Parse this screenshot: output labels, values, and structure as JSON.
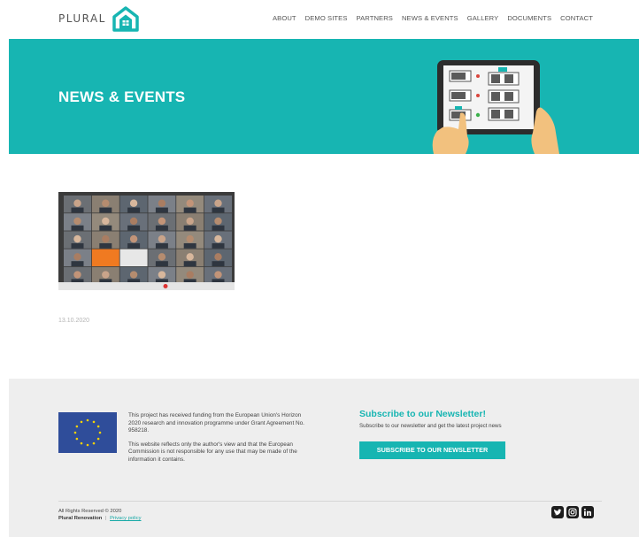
{
  "header": {
    "logo_text": "PLURAL",
    "nav": [
      "ABOUT",
      "DEMO SITES",
      "PARTNERS",
      "NEWS & EVENTS",
      "GALLERY",
      "DOCUMENTS",
      "CONTACT"
    ]
  },
  "banner": {
    "title": "NEWS & EVENTS"
  },
  "post": {
    "date": "13.10.2020"
  },
  "footer": {
    "funding_text": "This project has received funding from the European Union's Horizon 2020 research and innovation programme under Grant Agreement No. 958218.",
    "disclaimer_text": "This website reflects only the author's view and that the European Commission is not responsible for any use that may be made of the information it contains.",
    "newsletter_title": "Subscribe to our Newsletter!",
    "newsletter_sub": "Subscribe to our newsletter and get the latest project news",
    "newsletter_button": "SUBSCRIBE TO OUR NEWSLETTER",
    "rights": "All Rights Reserved © 2020",
    "brand": "Plural Renovation",
    "separator": "|",
    "privacy": "Privacy policy",
    "social_icons": [
      "twitter-icon",
      "instagram-icon",
      "linkedin-icon"
    ]
  },
  "colors": {
    "accent": "#17b5b2",
    "footer_bg": "#eeeeee"
  }
}
